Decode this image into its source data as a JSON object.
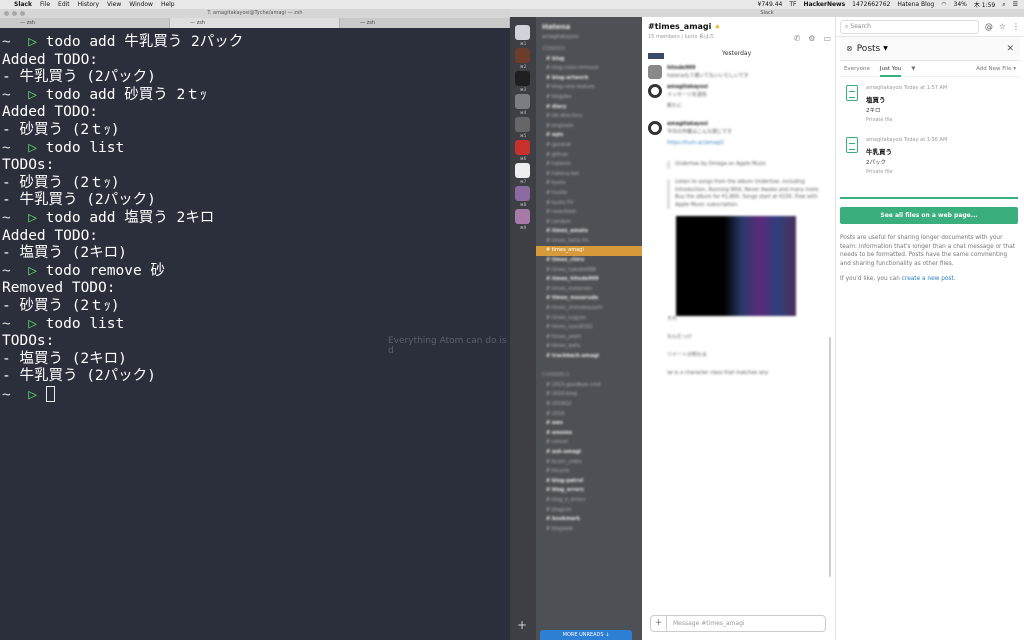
{
  "menubar": {
    "app_name": "Slack",
    "menus": [
      "File",
      "Edit",
      "History",
      "View",
      "Window",
      "Help"
    ],
    "status_price": "¥749.44",
    "status_tf": "TF",
    "status_hn": "HackerNews",
    "status_hn_count": "1472662762",
    "status_hatena": "Hatena Blog",
    "status_battery": "34%",
    "status_time": "木 1:59"
  },
  "terminal": {
    "window_title": "T. amagitakayosi@Tyche/amagi — zsh",
    "tabs": [
      "— zsh",
      "— zsh",
      "— zsh"
    ],
    "lines": [
      {
        "prompt": true,
        "text": "todo add 牛乳買う 2パック"
      },
      {
        "prompt": false,
        "text": "Added TODO:"
      },
      {
        "prompt": false,
        "text": "- 牛乳買う (2パック)"
      },
      {
        "prompt": true,
        "text": "todo add 砂買う 2ｔｯ"
      },
      {
        "prompt": false,
        "text": "Added TODO:"
      },
      {
        "prompt": false,
        "text": "- 砂買う (2ｔｯ)"
      },
      {
        "prompt": true,
        "text": "todo list"
      },
      {
        "prompt": false,
        "text": "TODOs:"
      },
      {
        "prompt": false,
        "text": "- 砂買う (2ｔｯ)"
      },
      {
        "prompt": false,
        "text": "- 牛乳買う (2パック)"
      },
      {
        "prompt": true,
        "text": "todo add 塩買う 2キロ"
      },
      {
        "prompt": false,
        "text": "Added TODO:"
      },
      {
        "prompt": false,
        "text": "- 塩買う (2キロ)"
      },
      {
        "prompt": true,
        "text": "todo remove 砂"
      },
      {
        "prompt": false,
        "text": "Removed TODO:"
      },
      {
        "prompt": false,
        "text": "- 砂買う (2ｔｯ)"
      },
      {
        "prompt": true,
        "text": "todo list"
      },
      {
        "prompt": false,
        "text": "TODOs:"
      },
      {
        "prompt": false,
        "text": "- 塩買う (2キロ)"
      },
      {
        "prompt": false,
        "text": "- 牛乳買う (2パック)"
      },
      {
        "prompt": true,
        "text": "",
        "cursor": true
      }
    ],
    "prompt_tilde": "~",
    "prompt_arrow": "▷",
    "ghost_text": "Everything Atom can do is d"
  },
  "slack": {
    "window_title": "Slack",
    "team_badges": [
      "⌘1",
      "⌘2",
      "⌘3",
      "⌘4",
      "⌘5",
      "⌘6",
      "⌘7",
      "⌘8",
      "⌘9"
    ],
    "team_name": "Hatena",
    "user_name": "amagitakayosi",
    "channels": [
      {
        "label": "STARRED",
        "type": "section"
      },
      {
        "label": "# blog",
        "type": "bold"
      },
      {
        "label": "# blog-color-removal",
        "type": "normal"
      },
      {
        "label": "# blog-artwork",
        "type": "bold"
      },
      {
        "label": "# blog-new-feature",
        "type": "normal"
      },
      {
        "label": "# blogdev",
        "type": "normal"
      },
      {
        "label": "# diary",
        "type": "bold"
      },
      {
        "label": "# dit-directory",
        "type": "normal"
      },
      {
        "label": "# engineer",
        "type": "normal"
      },
      {
        "label": "# epic",
        "type": "bold"
      },
      {
        "label": "# general",
        "type": "normal"
      },
      {
        "label": "# github",
        "type": "normal"
      },
      {
        "label": "# hatenio",
        "type": "normal"
      },
      {
        "label": "# hatena-bot",
        "type": "normal"
      },
      {
        "label": "# kyoto",
        "type": "normal"
      },
      {
        "label": "# hustle",
        "type": "normal"
      },
      {
        "label": "# kyoto-TV",
        "type": "normal"
      },
      {
        "label": "# newsfeed",
        "type": "normal"
      },
      {
        "label": "# random",
        "type": "normal"
      },
      {
        "label": "# times_amato",
        "type": "bold"
      },
      {
        "label": "# times_keita-fm",
        "type": "normal"
      },
      {
        "label": "# times_amagi",
        "type": "active"
      },
      {
        "label": "# times_chiro",
        "type": "bold"
      },
      {
        "label": "# times_hakobe998",
        "type": "normal"
      },
      {
        "label": "# times_hitode909",
        "type": "bold"
      },
      {
        "label": "# times_motemen",
        "type": "normal"
      },
      {
        "label": "# times_masaruda",
        "type": "bold"
      },
      {
        "label": "# times_shimobayashi",
        "type": "normal"
      },
      {
        "label": "# times_sugyan",
        "type": "normal"
      },
      {
        "label": "# times_syou6162",
        "type": "normal"
      },
      {
        "label": "# times_yoshi",
        "type": "normal"
      },
      {
        "label": "# times_wafu",
        "type": "normal"
      },
      {
        "label": "# trackback-amagi",
        "type": "bold"
      },
      {
        "label": "",
        "type": "spacer"
      },
      {
        "label": "CHANNELS",
        "type": "section"
      },
      {
        "label": "# 2015-goodbye-cmd",
        "type": "normal"
      },
      {
        "label": "# 2016-blog",
        "type": "normal"
      },
      {
        "label": "# 2016Q2",
        "type": "normal"
      },
      {
        "label": "# 2016",
        "type": "normal"
      },
      {
        "label": "# aws",
        "type": "bold"
      },
      {
        "label": "# emoms",
        "type": "bold"
      },
      {
        "label": "# cancel",
        "type": "normal"
      },
      {
        "label": "# ask-amagi",
        "type": "bold"
      },
      {
        "label": "# bcom_video",
        "type": "normal"
      },
      {
        "label": "# bicycle",
        "type": "normal"
      },
      {
        "label": "# blog-patrol",
        "type": "bold"
      },
      {
        "label": "# blog_errors",
        "type": "bold"
      },
      {
        "label": "# blog_e_errors",
        "type": "normal"
      },
      {
        "label": "# blogcon",
        "type": "normal"
      },
      {
        "label": "# bookmark",
        "type": "bold"
      },
      {
        "label": "# blogweb",
        "type": "normal"
      }
    ],
    "more_unreads": "MORE UNREADS",
    "channel_title": "#times_amagi",
    "channel_members": "15 members",
    "channel_meta_extra": "Iunto 系はカ",
    "date_divider": "Yesterday",
    "messages": [
      {
        "name": "hitode909",
        "text": "hatenaもう書いてもいいらしいです"
      },
      {
        "name": "amagitakayosi",
        "text": "メッセージを送信"
      },
      {
        "name": "",
        "text": "新たに"
      },
      {
        "name": "amagitakayosi",
        "text": "今日の作業はこんな感じです"
      },
      {
        "name": "",
        "text": "https://hum.ac/amagi2"
      },
      {
        "name": "",
        "text": "Undertow by Omega on Apple Music"
      },
      {
        "name": "",
        "text": "Listen to songs from the album Undertow, including Introduction, Running Wild, Never Awake and many more. Buy the album for ¥1,800. Songs start at ¥150. Free with Apple Music subscription."
      },
      {
        "name": "",
        "text": "それ"
      },
      {
        "name": "",
        "text": "なんだっけ"
      },
      {
        "name": "",
        "text": "ツイートが終わる"
      },
      {
        "name": "",
        "text": "\\w is a character class that matches any"
      }
    ],
    "message_placeholder": "Message #times_amagi",
    "search_placeholder": "Search",
    "posts": {
      "title": "Posts",
      "tabs": [
        "Everyone",
        "Just You"
      ],
      "add_new": "Add New File",
      "items": [
        {
          "author": "amagitakayosi",
          "time": "Today at 1:57 AM",
          "title": "塩買う",
          "body": "2キロ",
          "privacy": "Private file"
        },
        {
          "author": "amagitakayosi",
          "time": "Today at 1:56 AM",
          "title": "牛乳買う",
          "body": "2パック",
          "privacy": "Private file"
        }
      ],
      "see_all": "See all files on a web page...",
      "info": "Posts are useful for sharing longer documents with your team: information that's longer than a chat message or that needs to be formatted. Posts have the same commenting and sharing functionality as other files.",
      "info_prefix": "If you'd like, you can",
      "info_link": "create a new post",
      "info_suffix": "."
    }
  },
  "colors": {
    "terminal_bg": "#2a2f3b",
    "prompt_green": "#5fd26b",
    "slack_active": "#d79a3a",
    "posts_green": "#3aae7c",
    "unreads_blue": "#2d7fd6"
  }
}
